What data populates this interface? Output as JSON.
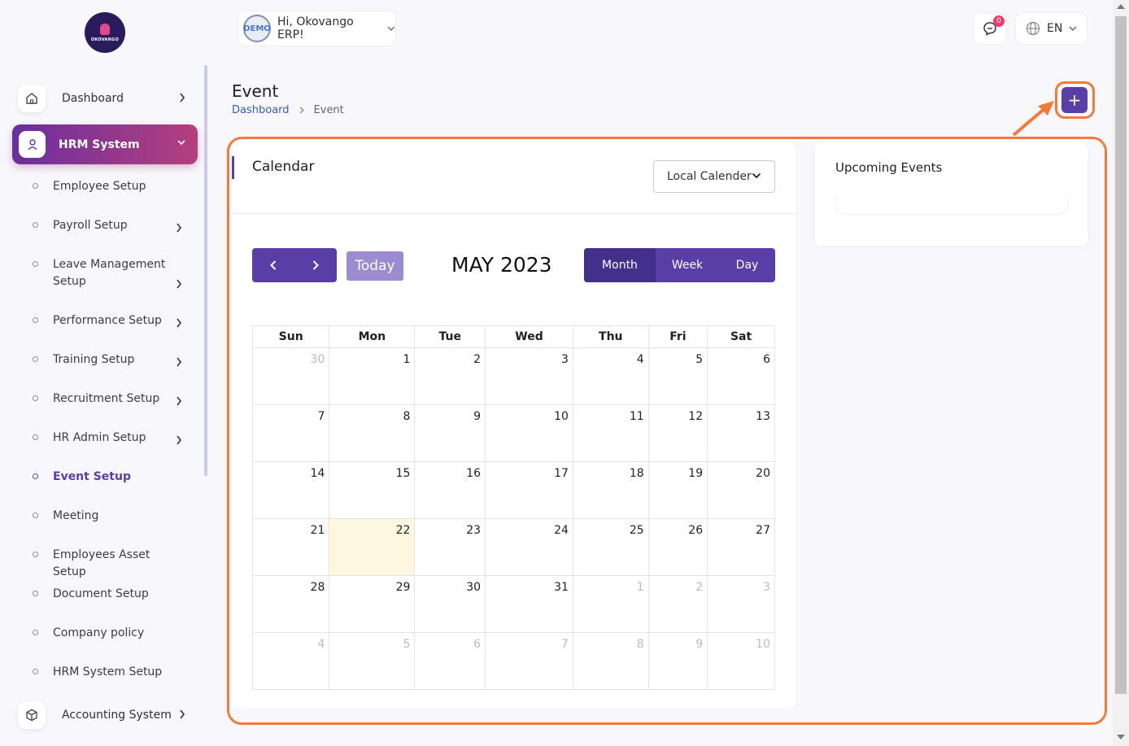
{
  "logo": {
    "text": "OKOVANGO"
  },
  "sidebar": {
    "dashboard": "Dashboard",
    "hrm": "HRM System",
    "items": [
      {
        "label": "Employee Setup"
      },
      {
        "label": "Payroll Setup"
      },
      {
        "label": "Leave Management Setup"
      },
      {
        "label": "Performance Setup"
      },
      {
        "label": "Training Setup"
      },
      {
        "label": "Recruitment Setup"
      },
      {
        "label": "HR Admin Setup"
      },
      {
        "label": "Event Setup"
      },
      {
        "label": "Meeting"
      },
      {
        "label": "Employees Asset Setup"
      },
      {
        "label": "Document Setup"
      },
      {
        "label": "Company policy"
      },
      {
        "label": "HRM System Setup"
      }
    ],
    "accounting": "Accounting System"
  },
  "header": {
    "avatar_text": "DEMO",
    "greeting": "Hi, Okovango ERP!",
    "notifications": "0",
    "language": "EN"
  },
  "page": {
    "title": "Event",
    "breadcrumb": [
      "Dashboard",
      "Event"
    ],
    "add_label": "+"
  },
  "calendar": {
    "title": "Calendar",
    "select_value": "Local Calender",
    "today_label": "Today",
    "month_label": "MAY 2023",
    "views": [
      "Month",
      "Week",
      "Day"
    ],
    "weekdays": [
      "Sun",
      "Mon",
      "Tue",
      "Wed",
      "Thu",
      "Fri",
      "Sat"
    ],
    "weeks": [
      [
        "30",
        "1",
        "2",
        "3",
        "4",
        "5",
        "6"
      ],
      [
        "7",
        "8",
        "9",
        "10",
        "11",
        "12",
        "13"
      ],
      [
        "14",
        "15",
        "16",
        "17",
        "18",
        "19",
        "20"
      ],
      [
        "21",
        "22",
        "23",
        "24",
        "25",
        "26",
        "27"
      ],
      [
        "28",
        "29",
        "30",
        "31",
        "1",
        "2",
        "3"
      ],
      [
        "4",
        "5",
        "6",
        "7",
        "8",
        "9",
        "10"
      ]
    ]
  },
  "upcoming": {
    "title": "Upcoming Events"
  },
  "colors": {
    "accent": "#5a3ea8",
    "highlight": "#f47a3a",
    "today": "#fdf7df"
  }
}
